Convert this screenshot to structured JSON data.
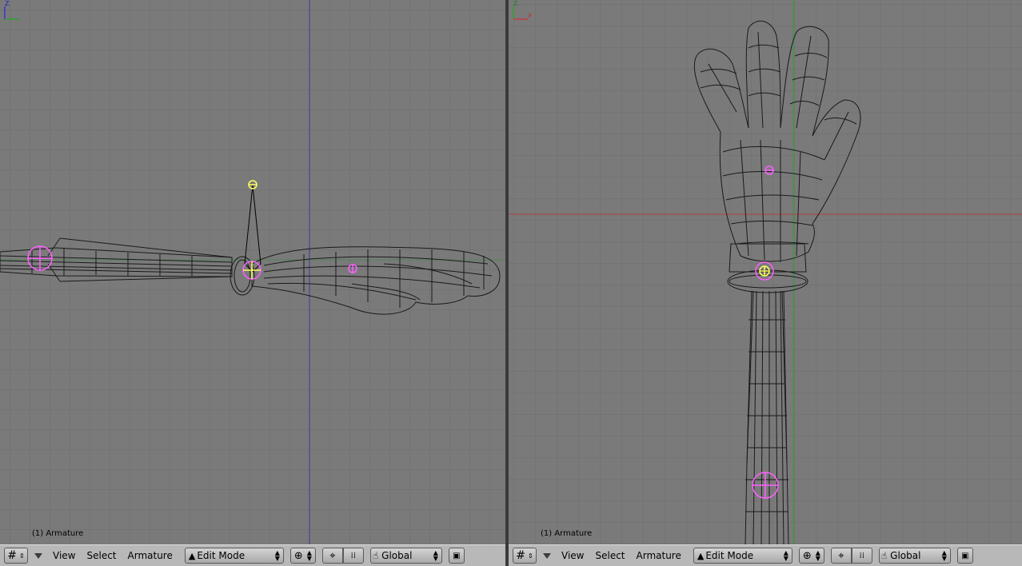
{
  "left_view": {
    "object_label": "(1) Armature",
    "axis_letters": {
      "up": "Z",
      "right": ""
    }
  },
  "right_view": {
    "object_label": "(1) Armature",
    "axis_letters": {
      "up": "Z",
      "right": "X"
    }
  },
  "header": {
    "view_label": "View",
    "select_label": "Select",
    "armature_label": "Armature",
    "mode_label": "Edit Mode",
    "orientation_label": "Global"
  },
  "icons": {
    "editor_type": "grid-icon",
    "menu_toggle": "triangle-down-icon",
    "mode": "armature-edit-icon",
    "draw_type": "wire-sphere-icon",
    "pivot": "crosshair-icon",
    "snap": "dotted-box-icon",
    "manipulator": "hand-icon",
    "render": "render-icon"
  },
  "colors": {
    "viewport_bg": "#7a7a7a",
    "grid_minor": "#707070",
    "grid_major": "#646464",
    "x_axis": "#b04040",
    "y_axis": "#30a030",
    "z_axis": "#3838b0",
    "bone_selected": "#ff60ff",
    "bone_active": "#ffff60",
    "header_bg": "#b8b8b8"
  }
}
